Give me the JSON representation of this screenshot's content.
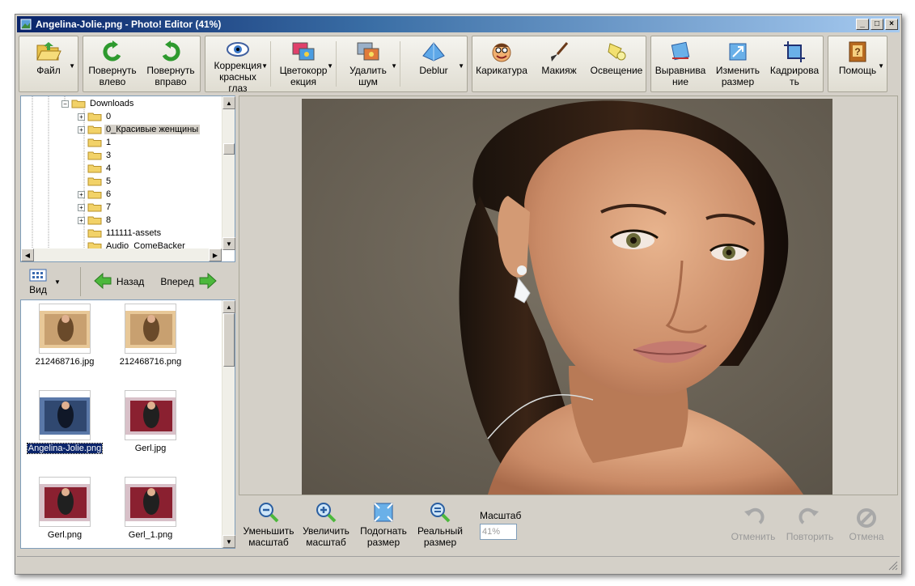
{
  "window": {
    "title": "Angelina-Jolie.png - Photo! Editor (41%)",
    "controls": {
      "minimize": "_",
      "maximize": "□",
      "close": "×"
    }
  },
  "toolbar": {
    "file": {
      "label": "Файл",
      "icon": "folder-open-icon"
    },
    "rotate_left": {
      "label": "Повернуть\nвлево",
      "icon": "rotate-left-icon"
    },
    "rotate_right": {
      "label": "Повернуть\nвправо",
      "icon": "rotate-right-icon"
    },
    "red_eye": {
      "label": "Коррекция\nкрасных\nглаз",
      "icon": "eye-icon"
    },
    "color_correction": {
      "label": "Цветокорр\nекция",
      "icon": "color-correction-icon"
    },
    "denoise": {
      "label": "Удалить\nшум",
      "icon": "denoise-icon"
    },
    "deblur": {
      "label": "Deblur",
      "icon": "prism-icon"
    },
    "caricature": {
      "label": "Карикатура",
      "icon": "face-icon"
    },
    "makeup": {
      "label": "Макияж",
      "icon": "brush-icon"
    },
    "lighting": {
      "label": "Освещение",
      "icon": "spotlight-icon"
    },
    "straighten": {
      "label": "Выравнива\nние",
      "icon": "straighten-icon"
    },
    "resize": {
      "label": "Изменить\nразмер",
      "icon": "resize-icon"
    },
    "crop": {
      "label": "Кадрирова\nть",
      "icon": "crop-icon"
    },
    "help": {
      "label": "Помощь",
      "icon": "help-book-icon"
    }
  },
  "tree": {
    "items": [
      {
        "label": "Downloads",
        "level": 0,
        "expander": "−"
      },
      {
        "label": "0",
        "level": 1,
        "expander": "+"
      },
      {
        "label": "0_Красивые женщины",
        "level": 1,
        "expander": "+",
        "selected": true
      },
      {
        "label": "1",
        "level": 1,
        "expander": ""
      },
      {
        "label": "3",
        "level": 1,
        "expander": ""
      },
      {
        "label": "4",
        "level": 1,
        "expander": ""
      },
      {
        "label": "5",
        "level": 1,
        "expander": ""
      },
      {
        "label": "6",
        "level": 1,
        "expander": "+"
      },
      {
        "label": "7",
        "level": 1,
        "expander": "+"
      },
      {
        "label": "8",
        "level": 1,
        "expander": "+"
      },
      {
        "label": "111111-assets",
        "level": 1,
        "expander": ""
      },
      {
        "label": "Audio_ComeBacker",
        "level": 1,
        "expander": ""
      }
    ]
  },
  "nav": {
    "view_label": "Вид",
    "back_label": "Назад",
    "forward_label": "Вперед"
  },
  "files": [
    {
      "name": "212468716.jpg",
      "selected": false
    },
    {
      "name": "212468716.png",
      "selected": false
    },
    {
      "name": "Angelina-Jolie.png",
      "selected": true
    },
    {
      "name": "Gerl.jpg",
      "selected": false
    },
    {
      "name": "Gerl.png",
      "selected": false
    },
    {
      "name": "Gerl_1.png",
      "selected": false
    }
  ],
  "bottom": {
    "zoom_out": "Уменьшить\nмасштаб",
    "zoom_in": "Увеличить\nмасштаб",
    "fit": "Подогнать\nразмер",
    "actual": "Реальный\nразмер",
    "scale_label": "Масштаб",
    "scale_value": "41%",
    "undo": "Отменить",
    "redo": "Повторить",
    "cancel": "Отмена"
  },
  "colors": {
    "title_start": "#0a246a",
    "title_end": "#a6caf0",
    "face": "#d4d0c8",
    "selection": "#0a246a",
    "photo_bg": "#6e6659"
  }
}
